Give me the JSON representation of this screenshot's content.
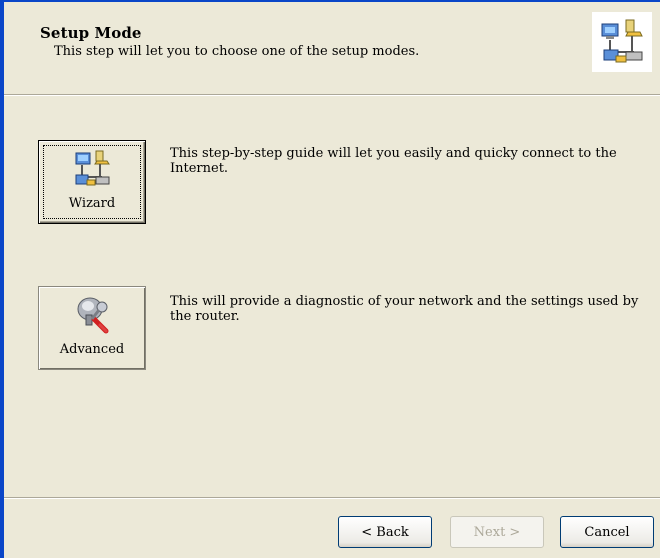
{
  "header": {
    "title": "Setup Mode",
    "subtitle": "This step will let you to choose one of the setup modes.",
    "icon": "network-computers-icon"
  },
  "modes": [
    {
      "label": "Wizard",
      "icon": "network-computers-icon",
      "description": "This step-by-step guide will let you easily and quicky connect to the Internet.",
      "focused": true
    },
    {
      "label": "Advanced",
      "icon": "wrench-tools-icon",
      "description": "This will provide a diagnostic of your network and the settings used by the router.",
      "focused": false
    }
  ],
  "footer": {
    "back_label": "< Back",
    "next_label": "Next >",
    "cancel_label": "Cancel"
  },
  "colors": {
    "background": "#ece9d8",
    "frame": "#0a46c8",
    "disabled_text": "#aca899"
  }
}
